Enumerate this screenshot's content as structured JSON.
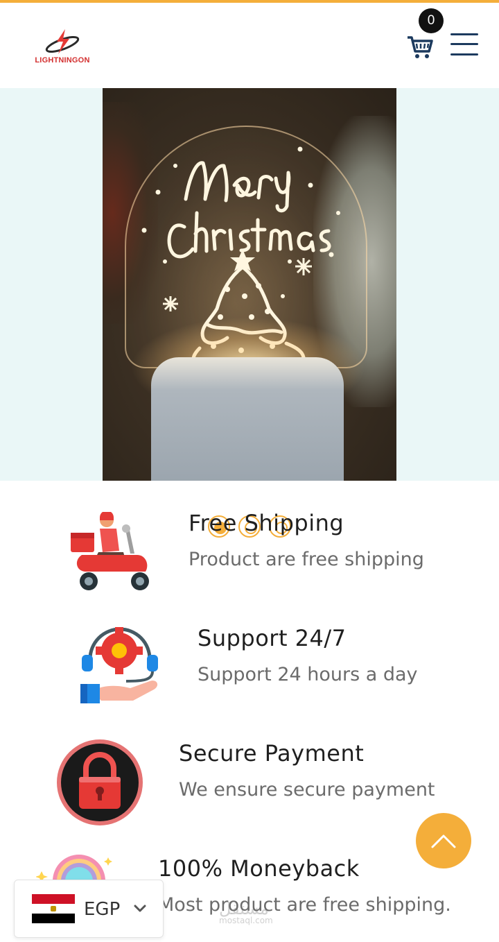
{
  "header": {
    "logo_text": "LIGHTNINGON",
    "cart_count": "0"
  },
  "hero": {
    "slide_count": 3,
    "active_slide": 1
  },
  "features": [
    {
      "title": "Free Shipping",
      "subtitle": "Product are free shipping"
    },
    {
      "title": "Support 24/7",
      "subtitle": "Support 24 hours a day"
    },
    {
      "title": "Secure Payment",
      "subtitle": "We ensure secure payment"
    },
    {
      "title": "100% Moneyback",
      "subtitle": "Most product are free shipping."
    }
  ],
  "currency": {
    "code": "EGP",
    "flag": "egypt-flag-icon"
  },
  "watermark": {
    "text": "مستقل",
    "sub": "mostaql.com"
  },
  "colors": {
    "accent": "#f4ae3a",
    "menu_icon": "#1c3a5e",
    "brand_red": "#d32f2f"
  }
}
